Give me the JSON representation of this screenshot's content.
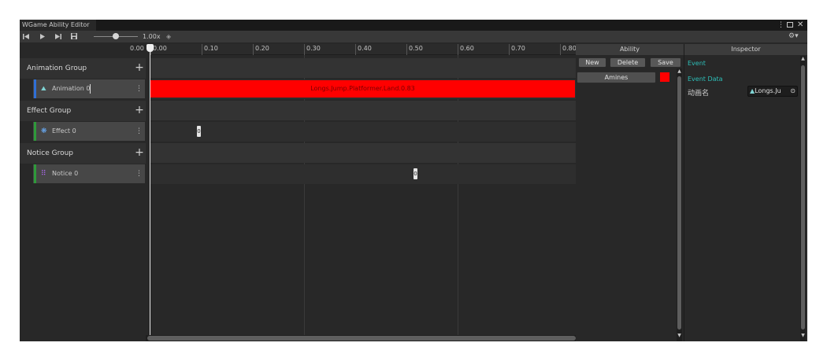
{
  "window": {
    "title": "WGame Ability Editor",
    "menu_icon": "kebab-menu-icon",
    "maximize_icon": "maximize-icon",
    "close_icon": "close-icon"
  },
  "toolbar": {
    "first_frame_icon": "skip-back-icon",
    "play_icon": "play-icon",
    "next_frame_icon": "step-forward-icon",
    "save_icon": "floppy-disk-icon",
    "zoom_label": "1.00x",
    "speed_icon": "speed-icon",
    "settings_icon": "gear-icon",
    "playhead_time": "0.00"
  },
  "timeline": {
    "ticks": [
      "0.00",
      "0.10",
      "0.20",
      "0.30",
      "0.40",
      "0.50",
      "0.60",
      "0.70",
      "0.80"
    ],
    "groups": [
      {
        "name": "Animation Group",
        "track": {
          "name": "Animation 0",
          "icon": "animation-icon",
          "accent": "#2f6fd6"
        }
      },
      {
        "name": "Effect Group",
        "track": {
          "name": "Effect 0",
          "icon": "effect-icon",
          "accent": "#2e9a3a"
        }
      },
      {
        "name": "Notice Group",
        "track": {
          "name": "Notice 0",
          "icon": "notice-grid-icon",
          "accent": "#2e9a3a"
        }
      }
    ],
    "animation_clip": {
      "label": "Longs.Jump.Platformer.Land.0.83",
      "color": "#ff0000"
    },
    "effect_key": {
      "label": "0"
    },
    "notice_key": {
      "label": "0"
    }
  },
  "ability_panel": {
    "header": "Ability",
    "new_label": "New",
    "delete_label": "Delete",
    "save_label": "Save",
    "item": "Amines",
    "item_color": "#ff0000"
  },
  "inspector": {
    "header": "Inspector",
    "event_label": "Event",
    "event_data_label": "Event Data",
    "field_label": "动画名",
    "field_value": "Longs.Ju",
    "accent": "#2dbfb8"
  }
}
